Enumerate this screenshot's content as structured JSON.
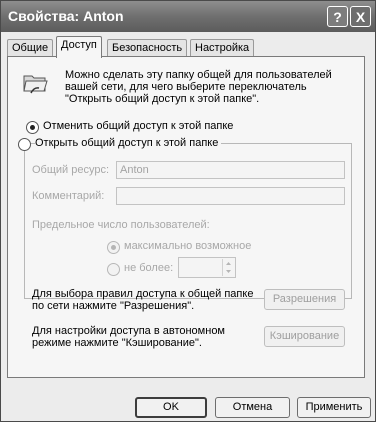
{
  "window": {
    "title": "Свойства: Anton",
    "help_glyph": "?",
    "close_glyph": "X"
  },
  "tabs": [
    {
      "label": "Общие"
    },
    {
      "label": "Доступ"
    },
    {
      "label": "Безопасность"
    },
    {
      "label": "Настройка"
    }
  ],
  "active_tab": "Доступ",
  "sharing": {
    "intro": [
      "Можно сделать эту папку общей для пользователей",
      "вашей сети, для чего выберите переключатель",
      "\"Открыть общий доступ к этой папке\"."
    ],
    "option_unshare": "Отменить общий доступ к этой папке",
    "option_share": "Открыть общий доступ к этой папке",
    "selected_option": "unshare",
    "share_name_label": "Общий ресурс:",
    "share_name_value": "Anton",
    "comment_label": "Комментарий:",
    "comment_value": "",
    "user_limit_label": "Предельное число пользователей:",
    "limit_max": "максимально возможное",
    "limit_no_more": "не более:",
    "limit_value": "",
    "permissions_text": [
      "Для выбора правил доступа к общей папке",
      "по сети нажмите \"Разрешения\"."
    ],
    "permissions_button": "Разрешения",
    "caching_text": [
      "Для настройки доступа в автономном",
      "режиме нажмите \"Кэширование\"."
    ],
    "caching_button": "Кэширование"
  },
  "footer": {
    "ok": "OK",
    "cancel": "Отмена",
    "apply": "Применить"
  }
}
